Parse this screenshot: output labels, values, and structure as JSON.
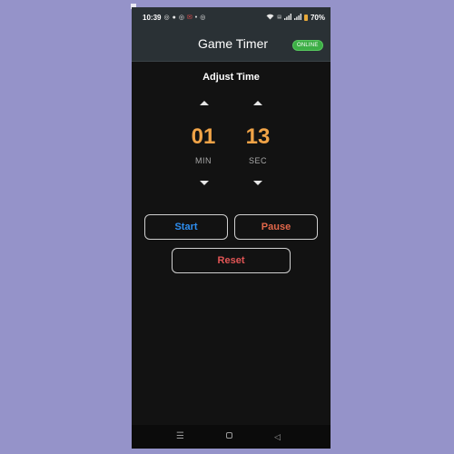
{
  "status_bar": {
    "time": "10:39",
    "battery_percent": "70%",
    "icons": [
      "whatsapp-icon",
      "chat-icon",
      "whatsapp-icon",
      "mail-icon",
      "dot-icon",
      "whatsapp-icon",
      "wifi-icon",
      "volte-icon",
      "signal-icon",
      "signal-icon",
      "battery-icon"
    ]
  },
  "app_bar": {
    "title": "Game Timer",
    "status_badge": "ONLINE",
    "badge_color": "#3cae45"
  },
  "timer": {
    "heading": "Adjust Time",
    "minutes": "01",
    "seconds": "13",
    "minutes_label": "MIN",
    "seconds_label": "SEC",
    "digit_color": "#f0a347"
  },
  "controls": {
    "start_label": "Start",
    "pause_label": "Pause",
    "reset_label": "Reset",
    "start_color": "#2e8ef0",
    "pause_color": "#e2674a",
    "reset_color": "#e25555"
  },
  "nav_bar": {
    "icons": [
      "recents-icon",
      "home-icon",
      "back-icon"
    ]
  }
}
